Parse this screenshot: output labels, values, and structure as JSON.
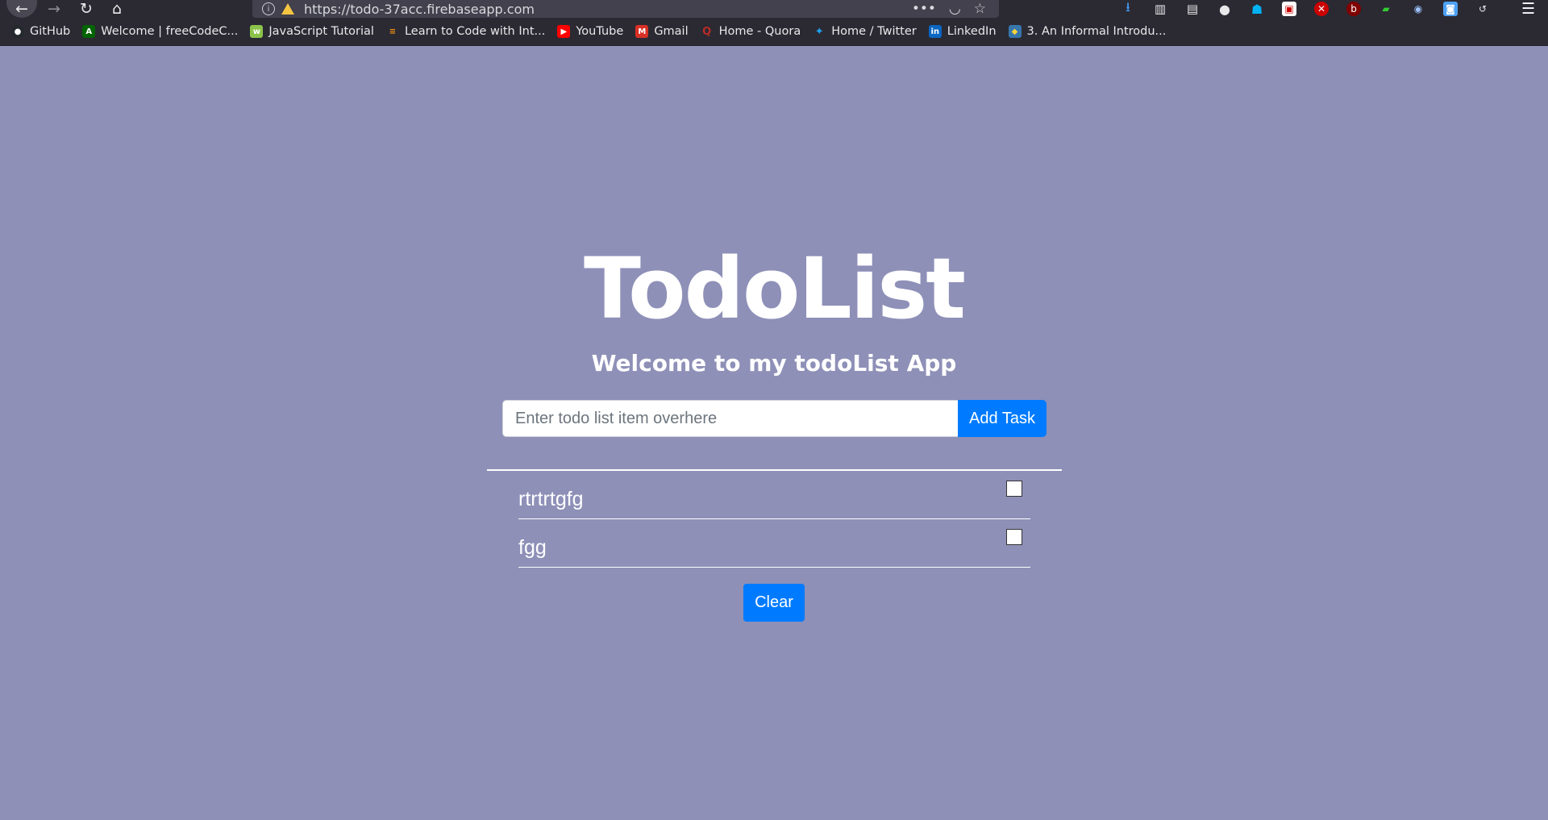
{
  "browser": {
    "url": "https://todo-37acc.firebaseapp.com",
    "bookmarks": [
      {
        "label": "GitHub",
        "icon": "github-icon",
        "color": "#24292e"
      },
      {
        "label": "Welcome | freeCodeC...",
        "icon": "freecodecamp-icon",
        "color": "#006400"
      },
      {
        "label": "JavaScript Tutorial",
        "icon": "w3schools-icon",
        "color": "#8bc34a"
      },
      {
        "label": "Learn to Code with Int...",
        "icon": "stackshare-icon",
        "color": "#f29111"
      },
      {
        "label": "YouTube",
        "icon": "youtube-icon",
        "color": "#ff0000"
      },
      {
        "label": "Gmail",
        "icon": "gmail-icon",
        "color": "#d93025"
      },
      {
        "label": "Home - Quora",
        "icon": "quora-icon",
        "color": "#b92b27"
      },
      {
        "label": "Home / Twitter",
        "icon": "twitter-icon",
        "color": "#1da1f2"
      },
      {
        "label": "LinkedIn",
        "icon": "linkedin-icon",
        "color": "#0a66c2"
      },
      {
        "label": "3. An Informal Introdu...",
        "icon": "python-icon",
        "color": "#3776ab"
      }
    ]
  },
  "app": {
    "title": "TodoList",
    "subtitle": "Welcome to my todoList App",
    "input": {
      "placeholder": "Enter todo list item overhere",
      "value": ""
    },
    "add_button": "Add Task",
    "todos": [
      {
        "text": "rtrtrtgfg",
        "checked": false
      },
      {
        "text": "fgg",
        "checked": false
      }
    ],
    "clear_button": "Clear"
  },
  "colors": {
    "background": "#8e90b8",
    "primary_button": "#007bff",
    "text": "#ffffff"
  }
}
